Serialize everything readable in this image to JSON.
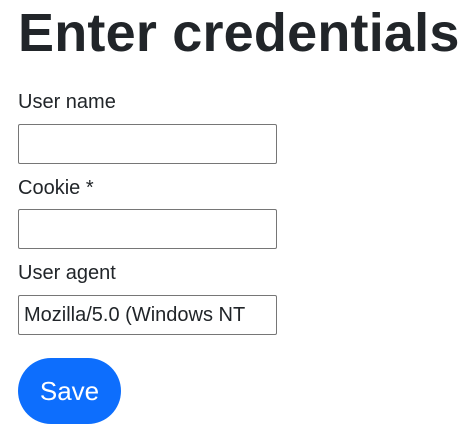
{
  "page": {
    "title": "Enter credentials"
  },
  "form": {
    "username": {
      "label": "User name",
      "value": ""
    },
    "cookie": {
      "label": "Cookie *",
      "value": ""
    },
    "user_agent": {
      "label": "User agent",
      "value": "Mozilla/5.0 (Windows NT"
    },
    "save_label": "Save"
  },
  "colors": {
    "primary_button": "#0d6efd",
    "text": "#212529",
    "input_border": "#767676"
  }
}
